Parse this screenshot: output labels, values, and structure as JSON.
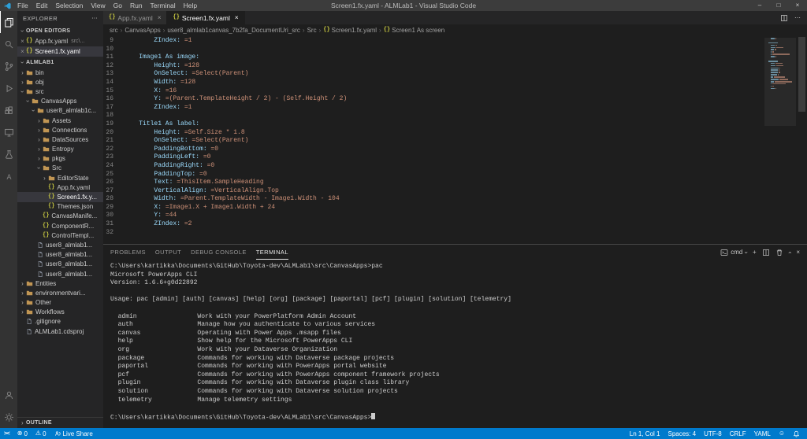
{
  "colors": {
    "accent": "#007acc",
    "titlebar_bg": "#3c3c3c",
    "activitybar_bg": "#333333",
    "sidebar_bg": "#252526",
    "editor_bg": "#1e1e1e",
    "yaml_key": "#9cdcfe",
    "yaml_value": "#ce9178",
    "braces_icon": "#cbcb41",
    "folder_icon": "#c09553",
    "selection_bg": "#37373d"
  },
  "title_bar": {
    "menus": [
      "File",
      "Edit",
      "Selection",
      "View",
      "Go",
      "Run",
      "Terminal",
      "Help"
    ],
    "title": "Screen1.fx.yaml - ALMLab1 - Visual Studio Code",
    "window_controls": [
      {
        "name": "minimize"
      },
      {
        "name": "maximize"
      },
      {
        "name": "close"
      }
    ]
  },
  "activity_bar": {
    "top": [
      {
        "name": "explorer",
        "active": true
      },
      {
        "name": "search",
        "active": false
      },
      {
        "name": "source-control",
        "active": false
      },
      {
        "name": "run-and-debug",
        "active": false
      },
      {
        "name": "extensions",
        "active": false
      },
      {
        "name": "remote-explorer",
        "active": false
      },
      {
        "name": "test",
        "active": false
      },
      {
        "name": "azure",
        "active": false
      }
    ],
    "bottom": [
      {
        "name": "account",
        "active": false
      },
      {
        "name": "settings",
        "active": false
      }
    ]
  },
  "sidebar": {
    "title": "EXPLORER",
    "open_editors": {
      "header": "OPEN EDITORS",
      "items": [
        {
          "label": "App.fx.yaml",
          "detail": "src\\...",
          "active": false
        },
        {
          "label": "Screen1.fx.yaml",
          "detail": "",
          "active": true
        }
      ]
    },
    "tree": {
      "header": "ALMLAB1",
      "items": [
        {
          "label": "bin",
          "kind": "folder",
          "level": 0,
          "expanded": false
        },
        {
          "label": "obj",
          "kind": "folder",
          "level": 0,
          "expanded": false
        },
        {
          "label": "src",
          "kind": "folder",
          "level": 0,
          "expanded": true
        },
        {
          "label": "CanvasApps",
          "kind": "folder",
          "level": 1,
          "expanded": true
        },
        {
          "label": "user8_almlab1c...",
          "kind": "folder",
          "level": 2,
          "expanded": true
        },
        {
          "label": "Assets",
          "kind": "folder",
          "level": 3,
          "expanded": false
        },
        {
          "label": "Connections",
          "kind": "folder",
          "level": 3,
          "expanded": false
        },
        {
          "label": "DataSources",
          "kind": "folder",
          "level": 3,
          "expanded": false
        },
        {
          "label": "Entropy",
          "kind": "folder",
          "level": 3,
          "expanded": false
        },
        {
          "label": "pkgs",
          "kind": "folder",
          "level": 3,
          "expanded": false
        },
        {
          "label": "Src",
          "kind": "folder",
          "level": 3,
          "expanded": true
        },
        {
          "label": "EditorState",
          "kind": "folder",
          "level": 4,
          "expanded": false
        },
        {
          "label": "App.fx.yaml",
          "kind": "file",
          "icon": "braces",
          "level": 4
        },
        {
          "label": "Screen1.fx.y...",
          "kind": "file",
          "icon": "braces",
          "level": 4,
          "selected": true
        },
        {
          "label": "Themes.json",
          "kind": "file",
          "icon": "braces",
          "level": 4
        },
        {
          "label": "CanvasManife...",
          "kind": "file",
          "icon": "braces",
          "level": 3
        },
        {
          "label": "ComponentR...",
          "kind": "file",
          "icon": "braces",
          "level": 3
        },
        {
          "label": "ControlTempl...",
          "kind": "file",
          "icon": "braces",
          "level": 3
        },
        {
          "label": "user8_almlab1...",
          "kind": "file",
          "icon": "file",
          "level": 2
        },
        {
          "label": "user8_almlab1...",
          "kind": "file",
          "icon": "file",
          "level": 2
        },
        {
          "label": "user8_almlab1...",
          "kind": "file",
          "icon": "file",
          "level": 2
        },
        {
          "label": "user8_almlab1...",
          "kind": "file",
          "icon": "file",
          "level": 2
        },
        {
          "label": "Entities",
          "kind": "folder",
          "level": 0,
          "expanded": false
        },
        {
          "label": "environmentvari...",
          "kind": "folder",
          "level": 0,
          "expanded": false
        },
        {
          "label": "Other",
          "kind": "folder",
          "level": 0,
          "expanded": false
        },
        {
          "label": "Workflows",
          "kind": "folder",
          "level": 0,
          "expanded": false
        },
        {
          "label": ".gitignore",
          "kind": "file",
          "icon": "file",
          "level": 0
        },
        {
          "label": "ALMLab1.cdsproj",
          "kind": "file",
          "icon": "file",
          "level": 0
        }
      ]
    },
    "outline": {
      "header": "OUTLINE"
    }
  },
  "editor": {
    "tabs": [
      {
        "label": "App.fx.yaml",
        "active": false
      },
      {
        "label": "Screen1.fx.yaml",
        "active": true
      }
    ],
    "actions": [
      {
        "name": "split-editor",
        "icon": "split"
      },
      {
        "name": "more-actions",
        "icon": "ellipsis"
      }
    ],
    "breadcrumbs": [
      {
        "label": "src"
      },
      {
        "label": "CanvasApps"
      },
      {
        "label": "user8_almlab1canvas_7b2fa_DocumentUri_src"
      },
      {
        "label": "Src"
      },
      {
        "label": "Screen1.fx.yaml",
        "icon": "braces"
      },
      {
        "label": "Screen1 As screen",
        "icon": "braces"
      }
    ],
    "code_lines": [
      {
        "num": 9,
        "indent": 8,
        "key": "ZIndex:",
        "value": "=1"
      },
      {
        "num": 10
      },
      {
        "num": 11,
        "indent": 4,
        "key": "Image1 As image:"
      },
      {
        "num": 12,
        "indent": 8,
        "key": "Height:",
        "value": "=128"
      },
      {
        "num": 13,
        "indent": 8,
        "key": "OnSelect:",
        "value": "=Select(Parent)"
      },
      {
        "num": 14,
        "indent": 8,
        "key": "Width:",
        "value": "=128"
      },
      {
        "num": 15,
        "indent": 8,
        "key": "X:",
        "value": "=16"
      },
      {
        "num": 16,
        "indent": 8,
        "key": "Y:",
        "value": "=(Parent.TemplateHeight / 2) - (Self.Height / 2)"
      },
      {
        "num": 17,
        "indent": 8,
        "key": "ZIndex:",
        "value": "=1"
      },
      {
        "num": 18
      },
      {
        "num": 19,
        "indent": 4,
        "key": "Title1 As label:"
      },
      {
        "num": 20,
        "indent": 8,
        "key": "Height:",
        "value": "=Self.Size * 1.8"
      },
      {
        "num": 21,
        "indent": 8,
        "key": "OnSelect:",
        "value": "=Select(Parent)"
      },
      {
        "num": 22,
        "indent": 8,
        "key": "PaddingBottom:",
        "value": "=0"
      },
      {
        "num": 23,
        "indent": 8,
        "key": "PaddingLeft:",
        "value": "=0"
      },
      {
        "num": 24,
        "indent": 8,
        "key": "PaddingRight:",
        "value": "=0"
      },
      {
        "num": 25,
        "indent": 8,
        "key": "PaddingTop:",
        "value": "=0"
      },
      {
        "num": 26,
        "indent": 8,
        "key": "Text:",
        "value": "=ThisItem.SampleHeading"
      },
      {
        "num": 27,
        "indent": 8,
        "key": "VerticalAlign:",
        "value": "=VerticalAlign.Top"
      },
      {
        "num": 28,
        "indent": 8,
        "key": "Width:",
        "value": "=Parent.TemplateWidth - Image1.Width - 104"
      },
      {
        "num": 29,
        "indent": 8,
        "key": "X:",
        "value": "=Image1.X + Image1.Width + 24"
      },
      {
        "num": 30,
        "indent": 8,
        "key": "Y:",
        "value": "=44"
      },
      {
        "num": 31,
        "indent": 8,
        "key": "ZIndex:",
        "value": "=2"
      },
      {
        "num": 32
      }
    ]
  },
  "panel": {
    "tabs": [
      {
        "label": "PROBLEMS",
        "active": false
      },
      {
        "label": "OUTPUT",
        "active": false
      },
      {
        "label": "DEBUG CONSOLE",
        "active": false
      },
      {
        "label": "TERMINAL",
        "active": true
      }
    ],
    "shell_label": "cmd",
    "actions": [
      {
        "name": "terminal-picker",
        "icon": "terminal",
        "label": "cmd",
        "chevron": true
      },
      {
        "name": "new-terminal",
        "icon": "plus"
      },
      {
        "name": "split-terminal",
        "icon": "split"
      },
      {
        "name": "kill-terminal",
        "icon": "trash"
      },
      {
        "name": "maximize-panel",
        "icon": "chevron-up"
      },
      {
        "name": "close-panel",
        "icon": "close"
      }
    ],
    "terminal_lines": [
      "C:\\Users\\kartikka\\Documents\\GitHub\\Toyota-dev\\ALMLab1\\src\\CanvasApps>pac",
      "Microsoft PowerApps CLI",
      "Version: 1.6.6+g0d22892",
      "",
      "Usage: pac [admin] [auth] [canvas] [help] [org] [package] [paportal] [pcf] [plugin] [solution] [telemetry]",
      "",
      "  admin                Work with your PowerPlatform Admin Account",
      "  auth                 Manage how you authenticate to various services",
      "  canvas               Operating with Power Apps .msapp files",
      "  help                 Show help for the Microsoft PowerApps CLI",
      "  org                  Work with your Dataverse Organization",
      "  package              Commands for working with Dataverse package projects",
      "  paportal             Commands for working with PowerApps portal website",
      "  pcf                  Commands for working with PowerApps component framework projects",
      "  plugin               Commands for working with Dataverse plugin class library",
      "  solution             Commands for working with Dataverse solution projects",
      "  telemetry            Manage telemetry settings",
      "",
      "C:\\Users\\kartikka\\Documents\\GitHub\\Toyota-dev\\ALMLab1\\src\\CanvasApps>"
    ],
    "cursor_visible": true
  },
  "status_bar": {
    "left": [
      {
        "name": "remote",
        "icon": "remote",
        "label": ""
      },
      {
        "name": "problems",
        "icon": "error",
        "label": "0"
      },
      {
        "name": "warnings",
        "icon": "warning",
        "label": "0"
      },
      {
        "name": "live-share",
        "icon": "live-share",
        "label": "Live Share"
      }
    ],
    "right": [
      {
        "name": "cursor-position",
        "label": "Ln 1, Col 1"
      },
      {
        "name": "indentation",
        "label": "Spaces: 4"
      },
      {
        "name": "encoding",
        "label": "UTF-8"
      },
      {
        "name": "eol",
        "label": "CRLF"
      },
      {
        "name": "language-mode",
        "label": "YAML"
      },
      {
        "name": "feedback",
        "icon": "feedback",
        "label": ""
      },
      {
        "name": "notifications",
        "icon": "bell",
        "label": ""
      }
    ]
  }
}
